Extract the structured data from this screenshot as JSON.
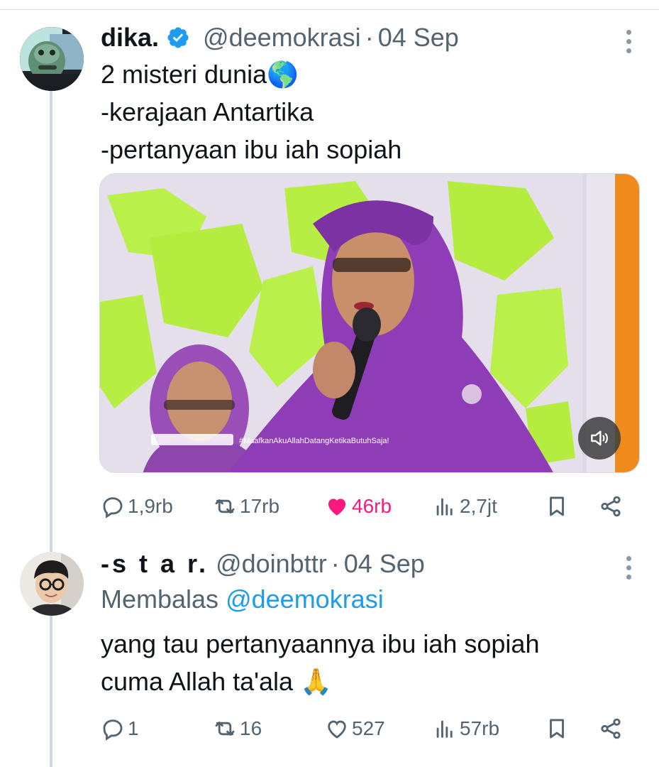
{
  "tweet": {
    "author_name": "dika.",
    "handle": "@deemokrasi",
    "separator": "·",
    "date": "04 Sep",
    "lines": [
      "2 misteri dunia🌎",
      "-kerajaan Antartika",
      "-pertanyaan ibu iah sopiah"
    ],
    "video_caption": "#MaafkanAkuAllahDatangKetikaButuhSaja!",
    "stats": {
      "replies": "1,9rb",
      "reposts": "17rb",
      "likes": "46rb",
      "views": "2,7jt"
    },
    "liked": true
  },
  "reply": {
    "author_name": "-s t a r.",
    "handle": "@doinbttr",
    "separator": "·",
    "date": "04 Sep",
    "replying_label": "Membalas",
    "replying_to": "@deemokrasi",
    "lines": [
      "yang tau pertanyaannya ibu iah sopiah",
      "cuma Allah ta'ala 🙏"
    ],
    "stats": {
      "replies": "1",
      "reposts": "16",
      "likes": "527",
      "views": "57rb"
    }
  },
  "colors": {
    "verified": "#1d9bf0",
    "like": "#f91880",
    "secondary_text": "#536471",
    "mention": "#1d9bf0",
    "thread_line": "#cfd9de"
  },
  "icons": [
    "verified-badge-icon",
    "more-options-icon",
    "reply-icon",
    "repost-icon",
    "like-icon",
    "views-icon",
    "bookmark-icon",
    "share-icon",
    "volume-icon"
  ]
}
